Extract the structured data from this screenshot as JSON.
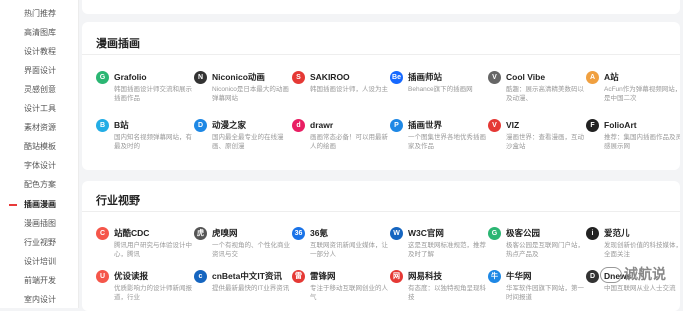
{
  "sidebar": {
    "items": [
      {
        "label": "热门推荐"
      },
      {
        "label": "高清图库"
      },
      {
        "label": "设计教程"
      },
      {
        "label": "界面设计"
      },
      {
        "label": "灵感创意"
      },
      {
        "label": "设计工具"
      },
      {
        "label": "素材资源"
      },
      {
        "label": "酷站模板"
      },
      {
        "label": "字体设计"
      },
      {
        "label": "配色方案"
      },
      {
        "label": "插画漫画",
        "active": true
      },
      {
        "label": "漫画插图"
      },
      {
        "label": "行业视野"
      },
      {
        "label": "设计培训"
      },
      {
        "label": "前端开发"
      },
      {
        "label": "室内设计"
      }
    ]
  },
  "sections": {
    "illustration": {
      "title": "漫画插画",
      "sites": [
        {
          "name": "Grafolio",
          "desc": "韩国插画设计师交流和展示插画作品",
          "logo": "G",
          "color": "#2bb673"
        },
        {
          "name": "Niconico动画",
          "desc": "Niconico是日本最大的动画弹幕网站",
          "logo": "N",
          "color": "#333333"
        },
        {
          "name": "SAKIROO",
          "desc": "韩国插画设计师，人设为主",
          "logo": "S",
          "color": "#e53935"
        },
        {
          "name": "插画师站",
          "desc": "Behance旗下的插画网",
          "logo": "Be",
          "color": "#1769ff"
        },
        {
          "name": "Cool Vibe",
          "desc": "酷趣：展示高清精美数码以及动漫、",
          "logo": "V",
          "color": "#666666"
        },
        {
          "name": "A站",
          "desc": "AcFun作为弹幕视频网站，是中国二次",
          "logo": "A",
          "color": "#f0a040"
        },
        {
          "name": "B站",
          "desc": "国内知名视频弹幕网站，有最及时的",
          "logo": "B",
          "color": "#23ade5"
        },
        {
          "name": "动漫之家",
          "desc": "国内最全最专业的在线漫画、原创漫",
          "logo": "D",
          "color": "#1e88e5"
        },
        {
          "name": "drawr",
          "desc": "画画常态必备！可以用最新人的绘画",
          "logo": "d",
          "color": "#e91e63"
        },
        {
          "name": "插画世界",
          "desc": "一个图集世界各地优秀插画家及作品",
          "logo": "P",
          "color": "#1e88e5"
        },
        {
          "name": "VIZ",
          "desc": "漫画世界：查看漫画，互动沙盒站",
          "logo": "V",
          "color": "#e53935"
        },
        {
          "name": "FolioArt",
          "desc": "推荐：集国内插画作品及灵感展示网",
          "logo": "F",
          "color": "#222222"
        }
      ]
    },
    "industry": {
      "title": "行业视野",
      "sites": [
        {
          "name": "站酷CDC",
          "desc": "腾讯用户研究与体验设计中心，腾讯",
          "logo": "C",
          "color": "#f5564a"
        },
        {
          "name": "虎嗅网",
          "desc": "一个有视角的、个性化商业资讯与交",
          "logo": "虎",
          "color": "#555555"
        },
        {
          "name": "36氪",
          "desc": "互联网资讯新闻业媒体，让一部分人",
          "logo": "36",
          "color": "#1a73e8"
        },
        {
          "name": "W3C官网",
          "desc": "这是互联网标准规范，推荐及时了解",
          "logo": "W",
          "color": "#1565c0"
        },
        {
          "name": "极客公园",
          "desc": "极客公园是互联网门户站，热点产品及",
          "logo": "G",
          "color": "#2bb673"
        },
        {
          "name": "爱范儿",
          "desc": "发现创新价值的科技媒体，全面关注",
          "logo": "i",
          "color": "#222222"
        },
        {
          "name": "优设读报",
          "desc": "优质影响力的设计师新闻报道，行业",
          "logo": "U",
          "color": "#f5564a"
        },
        {
          "name": "cnBeta中文IT资讯",
          "desc": "提供最新最快的IT业界资讯",
          "logo": "c",
          "color": "#1565c0"
        },
        {
          "name": "雷锋网",
          "desc": "专注于移动互联网创业的人气",
          "logo": "雷",
          "color": "#e53935"
        },
        {
          "name": "网易科技",
          "desc": "有态度：以独特视角呈现科技",
          "logo": "网",
          "color": "#e53935"
        },
        {
          "name": "牛华网",
          "desc": "华军软件园旗下网站，第一时间报道",
          "logo": "牛",
          "color": "#1e88e5"
        },
        {
          "name": "Dnews",
          "desc": "中国互联网从业人士交流",
          "logo": "D",
          "color": "#333333"
        }
      ]
    }
  },
  "watermark": {
    "text": "诚航说"
  }
}
